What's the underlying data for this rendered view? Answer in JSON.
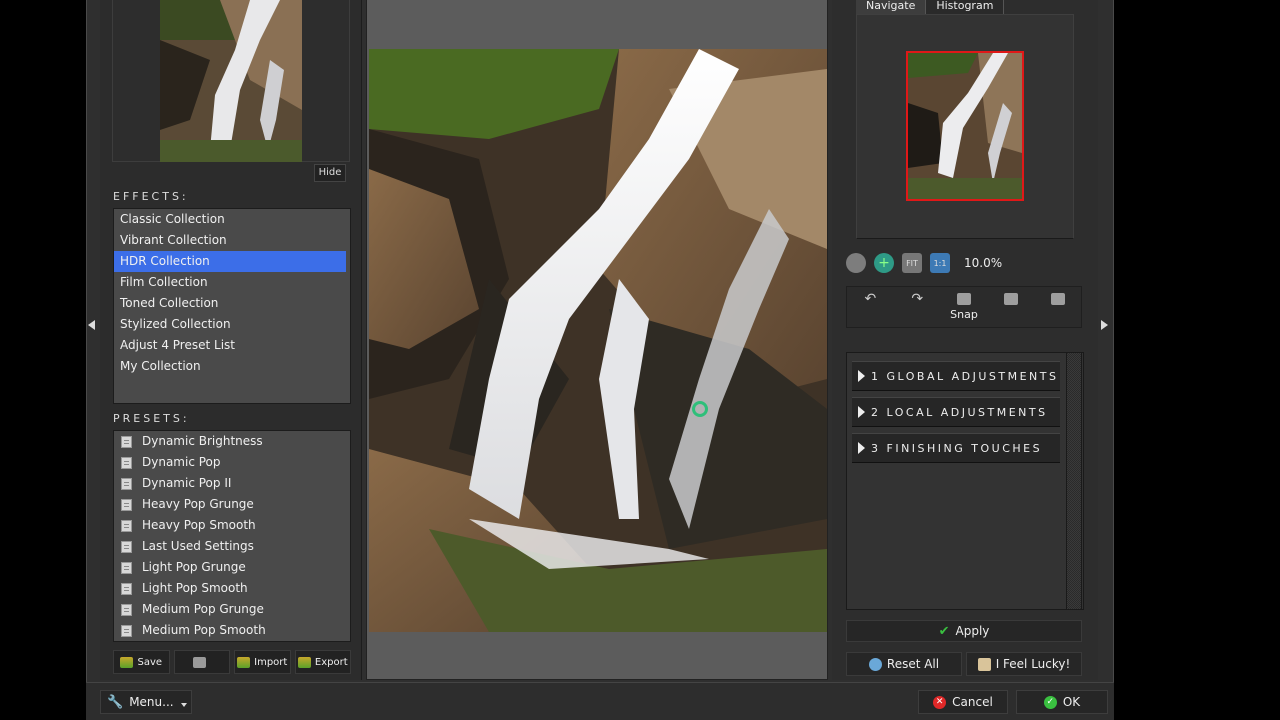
{
  "left_panel": {
    "hide_label": "Hide",
    "effects_label": "EFFECTS:",
    "effects": [
      {
        "label": "Classic Collection",
        "selected": false
      },
      {
        "label": "Vibrant Collection",
        "selected": false
      },
      {
        "label": "HDR Collection",
        "selected": true
      },
      {
        "label": "Film Collection",
        "selected": false
      },
      {
        "label": "Toned Collection",
        "selected": false
      },
      {
        "label": "Stylized Collection",
        "selected": false
      },
      {
        "label": "Adjust 4 Preset List",
        "selected": false
      },
      {
        "label": "My Collection",
        "selected": false
      }
    ],
    "presets_label": "PRESETS:",
    "presets": [
      "Dynamic Brightness",
      "Dynamic Pop",
      "Dynamic Pop II",
      "Heavy Pop Grunge",
      "Heavy Pop Smooth",
      "Last Used Settings",
      "Light Pop Grunge",
      "Light Pop Smooth",
      "Medium Pop Grunge",
      "Medium Pop Smooth"
    ],
    "preset_buttons": {
      "save": "Save",
      "disabled": "",
      "import": "Import",
      "export": "Export"
    }
  },
  "right_panel": {
    "tabs": [
      "Navigate",
      "Histogram"
    ],
    "active_tab": "Navigate",
    "zoom_level": "10.0%",
    "zoom_icons": [
      "zoom-out-icon",
      "zoom-in-icon",
      "fit-icon",
      "one-to-one-icon"
    ],
    "history": {
      "snap_label": "Snap"
    },
    "adjustments": [
      "1 GLOBAL ADJUSTMENTS",
      "2 LOCAL ADJUSTMENTS",
      "3 FINISHING TOUCHES"
    ],
    "apply_label": "Apply",
    "reset_label": "Reset All",
    "lucky_label": "I Feel Lucky!"
  },
  "footer": {
    "menu_label": "Menu...",
    "cancel_label": "Cancel",
    "ok_label": "OK"
  },
  "colors": {
    "selection": "#3c6ee8",
    "nav_frame": "#e01818",
    "ok_green": "#3ac040",
    "cancel_red": "#e02828"
  }
}
